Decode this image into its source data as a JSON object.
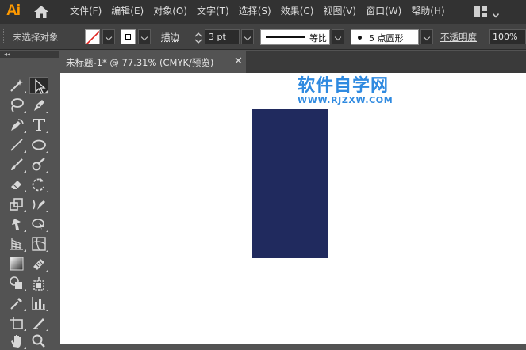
{
  "app": {
    "logo": "Ai"
  },
  "menu": [
    "文件(F)",
    "编辑(E)",
    "对象(O)",
    "文字(T)",
    "选择(S)",
    "效果(C)",
    "视图(V)",
    "窗口(W)",
    "帮助(H)"
  ],
  "control_bar": {
    "selection_label": "未选择对象",
    "stroke_label": "描边",
    "stroke_weight": "3 pt",
    "profile_label": "等比",
    "brush_label": "5 点圆形",
    "opacity_label": "不透明度",
    "opacity_value": "100%"
  },
  "document_tab": {
    "title": "未标题-1* @ 77.31% (CMYK/预览)",
    "close": "✕"
  },
  "toolbar": {
    "collapse": "◂◂",
    "tools": [
      "magic-wand-icon",
      "direct-selection-icon",
      "lasso-icon",
      "pen-icon",
      "curvature-icon",
      "type-icon",
      "line-segment-icon",
      "ellipse-icon",
      "paintbrush-icon",
      "shaper-icon",
      "eraser-icon",
      "rotate-icon",
      "scale-icon",
      "warp-icon",
      "puppet-warp-icon",
      "free-transform-icon",
      "perspective-grid-icon",
      "mesh-icon",
      "gradient-icon",
      "slice-eraser-icon",
      "shape-builder-icon",
      "live-paint-icon",
      "eyedropper-icon",
      "column-graph-icon",
      "artboard-icon",
      "slice-icon",
      "hand-icon",
      "zoom-icon"
    ]
  },
  "canvas": {
    "shape_fill": "#202a5e",
    "watermark_title": "软件自学网",
    "watermark_url": "WWW.RJZXW.COM",
    "watermark_color": "#2f8ae0"
  }
}
